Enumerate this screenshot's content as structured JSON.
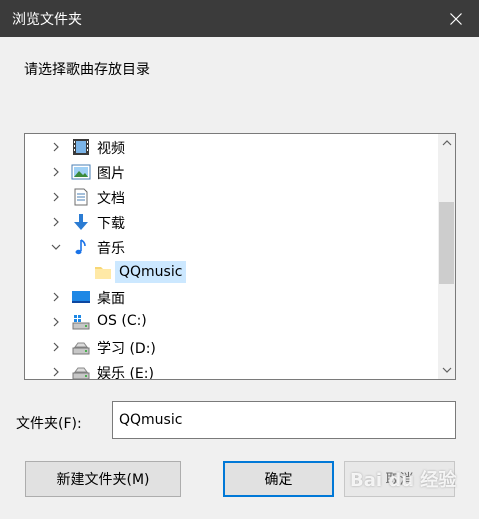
{
  "window": {
    "title": "浏览文件夹",
    "close_icon": "close-icon"
  },
  "prompt": "请选择歌曲存放目录",
  "tree": {
    "items": [
      {
        "label": "视频",
        "icon": "video-folder-icon",
        "expanded": false,
        "has_children": true
      },
      {
        "label": "图片",
        "icon": "pictures-folder-icon",
        "expanded": false,
        "has_children": true
      },
      {
        "label": "文档",
        "icon": "documents-folder-icon",
        "expanded": false,
        "has_children": true
      },
      {
        "label": "下载",
        "icon": "download-folder-icon",
        "expanded": false,
        "has_children": true
      },
      {
        "label": "音乐",
        "icon": "music-note-icon",
        "expanded": true,
        "has_children": true
      },
      {
        "label": "QQmusic",
        "icon": "folder-icon",
        "selected": true,
        "has_children": false
      },
      {
        "label": "桌面",
        "icon": "desktop-icon",
        "expanded": false,
        "has_children": true
      },
      {
        "label": "OS (C:)",
        "icon": "os-drive-icon",
        "expanded": false,
        "has_children": true
      },
      {
        "label": "学习 (D:)",
        "icon": "drive-icon",
        "expanded": false,
        "has_children": true
      },
      {
        "label": "娱乐 (E:)",
        "icon": "drive-icon",
        "expanded": false,
        "has_children": true
      }
    ]
  },
  "folder_field": {
    "label": "文件夹(F):",
    "value": "QQmusic"
  },
  "buttons": {
    "new_folder": "新建文件夹(M)",
    "ok": "确定",
    "cancel": "取消"
  },
  "watermark": "Bai du 经验",
  "colors": {
    "titlebar": "#3b3b3b",
    "selection": "#cce8ff",
    "accent": "#0078d7"
  }
}
